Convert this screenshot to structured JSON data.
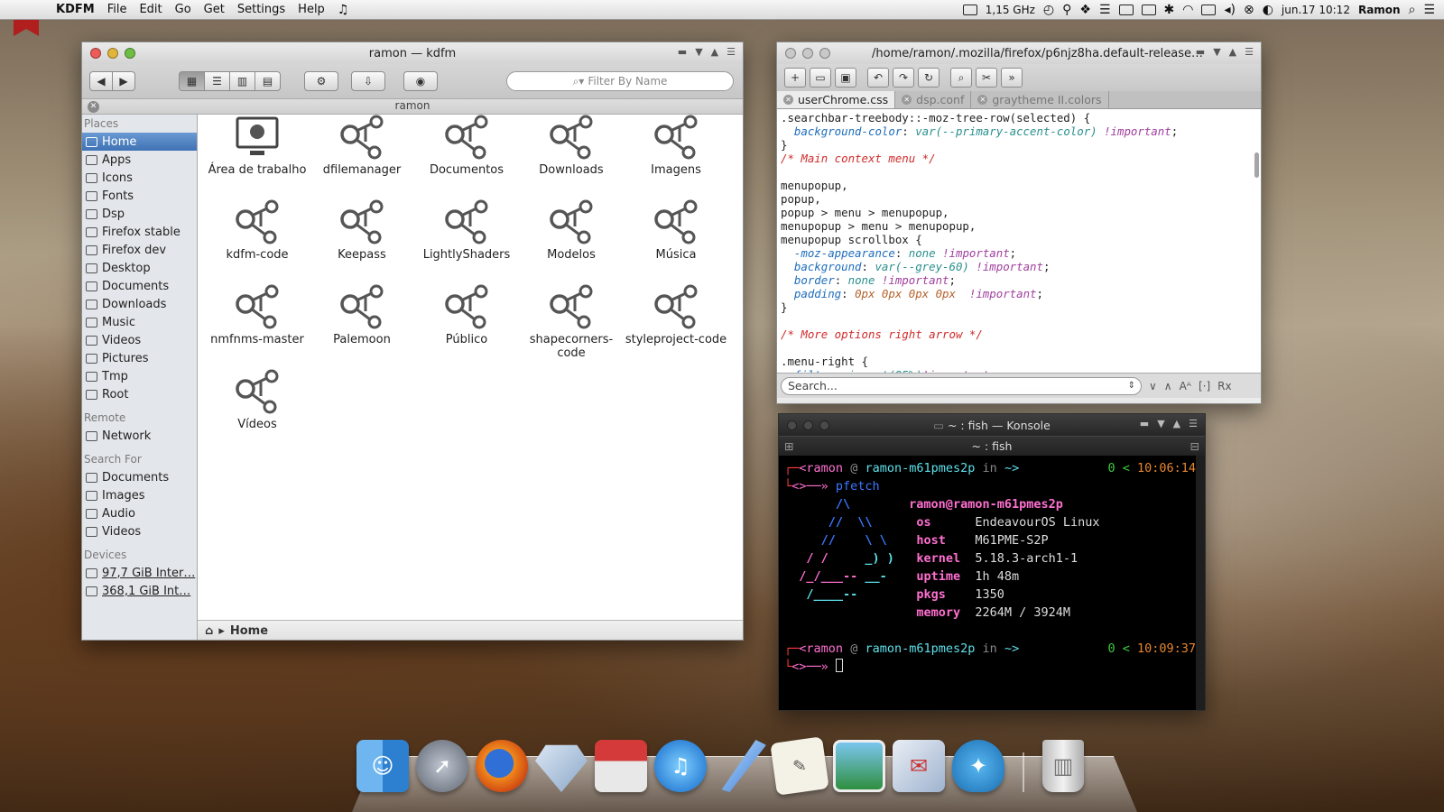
{
  "menubar": {
    "app": "KDFM",
    "menus": [
      "File",
      "Edit",
      "Go",
      "Get",
      "Settings",
      "Help"
    ],
    "cpu": "1,15 GHz",
    "datetime": "jun.17 10:12",
    "user": "Ramon"
  },
  "kdfm": {
    "title": "ramon — kdfm",
    "filter_placeholder": "Filter By Name",
    "path": "ramon",
    "status": "Home",
    "sidebar": {
      "places_header": "Places",
      "places": [
        "Home",
        "Apps",
        "Icons",
        "Fonts",
        "Dsp",
        "Firefox stable",
        "Firefox dev",
        "Desktop",
        "Documents",
        "Downloads",
        "Music",
        "Videos",
        "Pictures",
        "Tmp",
        "Root"
      ],
      "remote_header": "Remote",
      "remote": [
        "Network"
      ],
      "search_header": "Search For",
      "search": [
        "Documents",
        "Images",
        "Audio",
        "Videos"
      ],
      "devices_header": "Devices",
      "devices": [
        "97,7 GiB Inter…",
        "368,1 GiB Int…"
      ]
    },
    "files": [
      [
        "Área de trabalho",
        "dfilemanager",
        "Documentos",
        "Downloads",
        "Imagens"
      ],
      [
        "kdfm-code",
        "Keepass",
        "LightlyShaders",
        "Modelos",
        "Música"
      ],
      [
        "nmfnms-master",
        "Palemoon",
        "Público",
        "shapecorners-code",
        "styleproject-code"
      ],
      [
        "Vídeos"
      ]
    ]
  },
  "editor": {
    "title": "/home/ramon/.mozilla/firefox/p6njz8ha.default-release…",
    "tabs": [
      "userChrome.css",
      "dsp.conf",
      "graytheme II.colors"
    ],
    "search_placeholder": "Search..."
  },
  "konsole": {
    "title": "~ : fish — Konsole",
    "tab": "~ : fish",
    "user": "ramon",
    "host": "ramon-m61pmes2p",
    "dir": "~",
    "cmd": "pfetch",
    "time1": "10:06:14",
    "time2": "10:09:37",
    "status_prefix": "0 <",
    "info_user": "ramon@ramon-m61pmes2p",
    "info": [
      {
        "k": "os",
        "v": "EndeavourOS Linux"
      },
      {
        "k": "host",
        "v": "M61PME-S2P"
      },
      {
        "k": "kernel",
        "v": "5.18.3-arch1-1"
      },
      {
        "k": "uptime",
        "v": "1h 48m"
      },
      {
        "k": "pkgs",
        "v": "1350"
      },
      {
        "k": "memory",
        "v": "2264M / 3924M"
      }
    ]
  },
  "dock": {
    "icons": [
      "finder-icon",
      "launchpad-icon",
      "firefox-icon",
      "gem-icon",
      "package-icon",
      "itunes-icon",
      "quill-icon",
      "textedit-icon",
      "preview-icon",
      "mail-icon",
      "twitter-bird-icon",
      "trash-icon"
    ]
  }
}
